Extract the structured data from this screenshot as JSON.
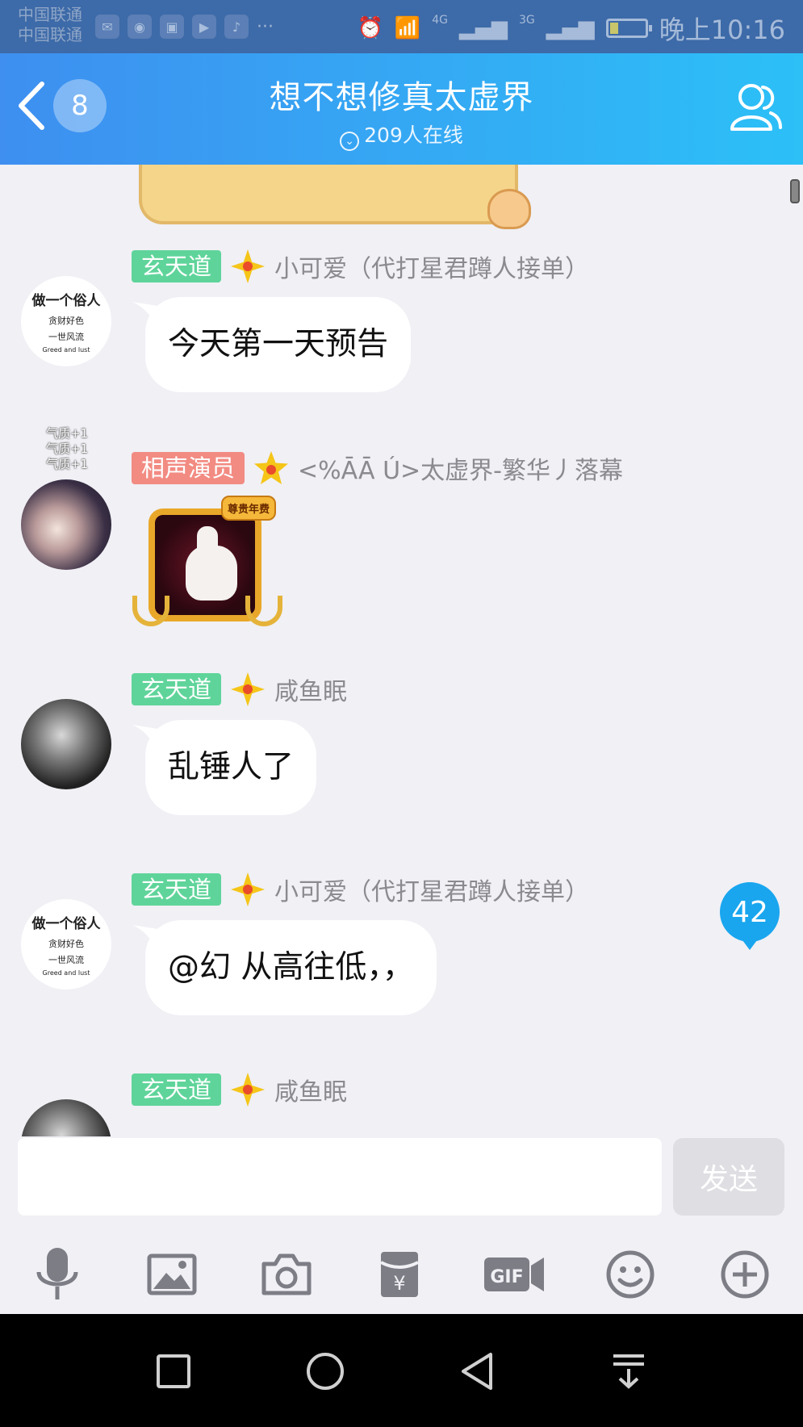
{
  "status_bar": {
    "carrier_1": "中国联通",
    "carrier_2": "中国联通",
    "more": "···",
    "net_1": "4G",
    "net_2": "3G",
    "time": "晚上10:16"
  },
  "header": {
    "unread_count": "8",
    "title": "想不想修真太虚界",
    "online": "209人在线"
  },
  "messages": [
    {
      "tag": "玄天道",
      "nickname": "小可爱（代打星君蹲人接单）",
      "text": "今天第一天预告",
      "avatar_lines": [
        "做一个俗人",
        "贪财好色",
        "一世风流",
        "Greed and lust"
      ]
    },
    {
      "tag": "相声演员",
      "nickname": "<%ĀĀ Ú>太虚界-繁华丿落幕",
      "halo_lines": [
        "气质+1",
        "气质+1",
        "气质+1"
      ],
      "gift_label": "尊贵年费"
    },
    {
      "tag": "玄天道",
      "nickname": "咸鱼眠",
      "text": "乱锤人了"
    },
    {
      "tag": "玄天道",
      "nickname": "小可爱（代打星君蹲人接单）",
      "text": "@幻 从高往低，，",
      "avatar_lines": [
        "做一个俗人",
        "贪财好色",
        "一世风流",
        "Greed and lust"
      ]
    },
    {
      "tag": "玄天道",
      "nickname": "咸鱼眠"
    }
  ],
  "unread_badge": "42",
  "input": {
    "value": "",
    "send_label": "发送"
  },
  "colors": {
    "header_start": "#3e8ff0",
    "header_end": "#2cc0f7",
    "tag_green": "#5fd49a",
    "tag_red": "#f28b82",
    "unread_blue": "#19a6ef"
  }
}
